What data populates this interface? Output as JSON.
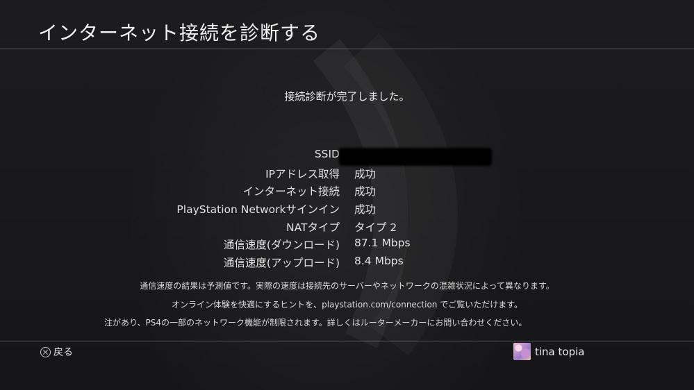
{
  "header": {
    "title": "インターネット接続を診断する"
  },
  "main": {
    "status_message": "接続診断が完了しました。",
    "results": [
      {
        "label": "SSID",
        "value": ""
      },
      {
        "label": "IPアドレス取得",
        "value": "成功"
      },
      {
        "label": "インターネット接続",
        "value": "成功"
      },
      {
        "label": "PlayStation Networkサインイン",
        "value": "成功"
      },
      {
        "label": "NATタイプ",
        "value": "タイプ 2"
      },
      {
        "label": "通信速度(ダウンロード)",
        "value": "87.1 Mbps"
      },
      {
        "label": "通信速度(アップロード)",
        "value": "8.4 Mbps"
      }
    ],
    "notes": [
      "通信速度の結果は予測値です。実際の速度は接続先のサーバーやネットワークの混雑状況によって異なります。",
      "オンライン体験を快適にするヒントを、playstation.com/connection でご覧いただけます。",
      "注があり、PS4の一部のネットワーク機能が制限されます。詳しくはルーターメーカーにお問い合わせください。"
    ]
  },
  "footer": {
    "back_label": "戻る",
    "back_icon": "cross-button-icon",
    "user_name": "tina topia"
  }
}
